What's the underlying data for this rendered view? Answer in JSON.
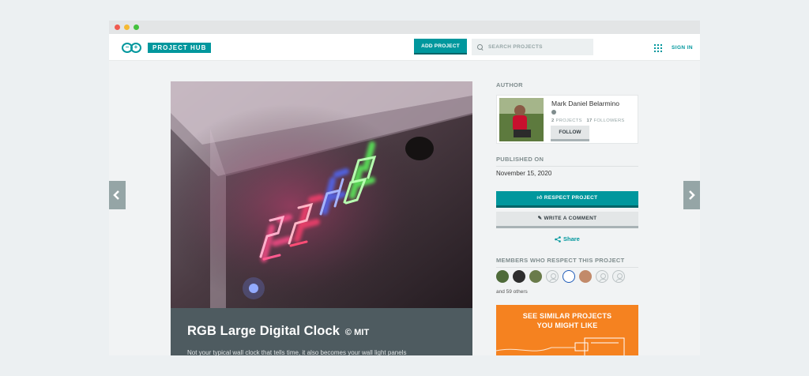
{
  "window": {
    "title": ""
  },
  "header": {
    "logo_text": "PROJECT HUB",
    "add_project_label": "ADD PROJECT",
    "search_placeholder": "SEARCH PROJECTS",
    "sign_in_label": "SIGN IN"
  },
  "project": {
    "title": "RGB Large Digital Clock",
    "license": "© MIT",
    "description": "Not your typical wall clock that tells time, it also becomes your wall light panels"
  },
  "sidebar": {
    "author_label": "AUTHOR",
    "author": {
      "name": "Mark Daniel Belarmino",
      "projects_count": "2",
      "projects_label": "PROJECTS",
      "followers_count": "17",
      "followers_label": "FOLLOWERS",
      "follow_label": "FOLLOW"
    },
    "published_label": "PUBLISHED ON",
    "published_date": "November 15, 2020",
    "respect_label": "RESPECT PROJECT",
    "comment_label": "WRITE A COMMENT",
    "share_label": "Share",
    "members_label": "MEMBERS WHO RESPECT THIS PROJECT",
    "members_others": "and 59 others",
    "similar_line1": "SEE SIMILAR PROJECTS",
    "similar_line2": "YOU MIGHT LIKE"
  },
  "colors": {
    "brand": "#00979d",
    "similar_bg": "#f58220",
    "title_panel": "#4e5b60"
  }
}
